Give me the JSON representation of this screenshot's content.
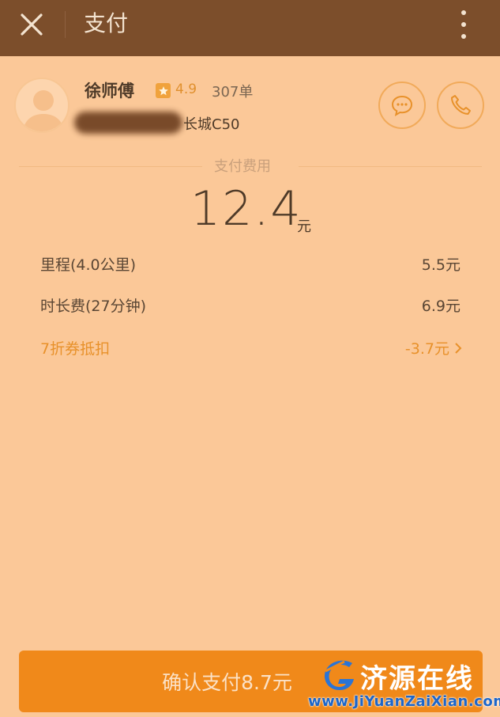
{
  "header": {
    "title": "支付",
    "close_icon": "close-icon",
    "more_icon": "more-vertical-icon"
  },
  "driver": {
    "name": "徐师傅",
    "rating": "4.9",
    "orders": "307单",
    "car_model": "长城C50"
  },
  "payment": {
    "section_title": "支付费用",
    "total": "12.4",
    "total_unit": "元",
    "items": [
      {
        "label": "里程(4.0公里)",
        "value": "5.5元"
      },
      {
        "label": "时长费(27分钟)",
        "value": "6.9元"
      },
      {
        "label": "7折券抵扣",
        "value": "-3.7元"
      }
    ]
  },
  "confirm": {
    "label": "确认支付8.7元"
  },
  "watermark": {
    "name": "济源在线",
    "url": "www.JiYuanZaiXian.com"
  },
  "colors": {
    "header_bg": "#7c4e2b",
    "page_bg": "#fbc898",
    "accent": "#f0891a",
    "discount": "#e8912a"
  }
}
